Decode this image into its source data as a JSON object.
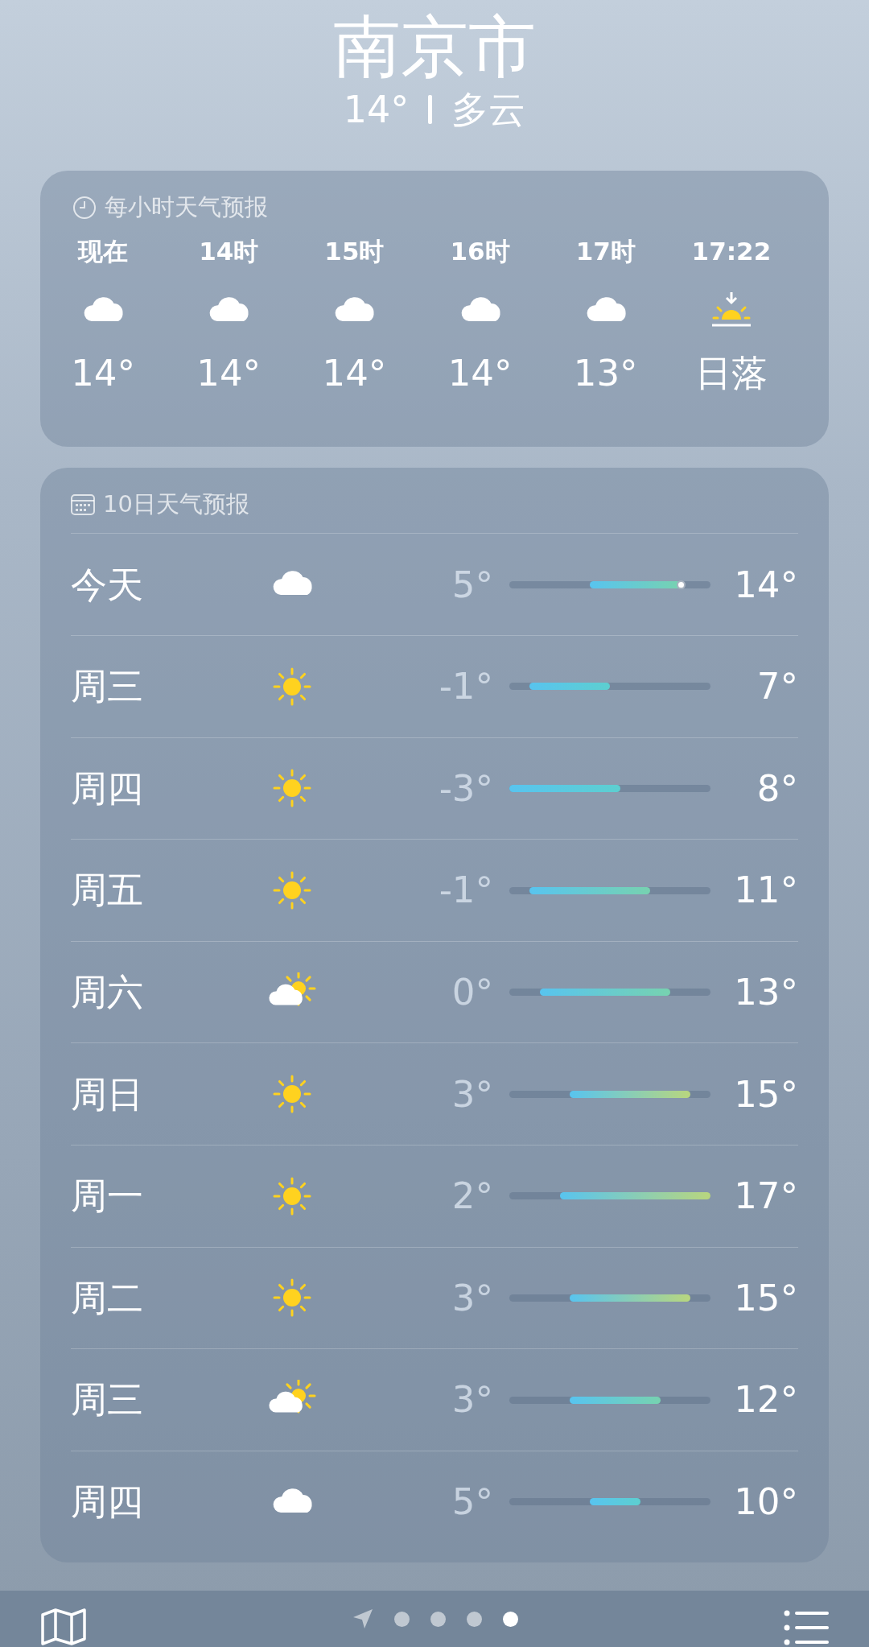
{
  "city": "南京市",
  "summary": {
    "temp": "14°",
    "condition": "多云"
  },
  "hourly": {
    "title": "每小时天气预报",
    "items": [
      {
        "time": "现在",
        "kind": "cloudy",
        "value": "14°"
      },
      {
        "time": "14时",
        "kind": "cloudy",
        "value": "14°"
      },
      {
        "time": "15时",
        "kind": "cloudy",
        "value": "14°"
      },
      {
        "time": "16时",
        "kind": "cloudy",
        "value": "14°"
      },
      {
        "time": "17时",
        "kind": "cloudy",
        "value": "13°"
      },
      {
        "time": "17:22",
        "kind": "sunset",
        "value": "日落"
      }
    ]
  },
  "daily": {
    "title": "10日天气预报",
    "rows": [
      {
        "day": "今天",
        "kind": "cloudy",
        "low": "5°",
        "high": "14°",
        "current": true
      },
      {
        "day": "周三",
        "kind": "sunny",
        "low": "-1°",
        "high": "7°",
        "current": false
      },
      {
        "day": "周四",
        "kind": "sunny",
        "low": "-3°",
        "high": "8°",
        "current": false
      },
      {
        "day": "周五",
        "kind": "sunny",
        "low": "-1°",
        "high": "11°",
        "current": false
      },
      {
        "day": "周六",
        "kind": "partly_sunny",
        "low": "0°",
        "high": "13°",
        "current": false
      },
      {
        "day": "周日",
        "kind": "sunny",
        "low": "3°",
        "high": "15°",
        "current": false
      },
      {
        "day": "周一",
        "kind": "sunny",
        "low": "2°",
        "high": "17°",
        "current": false
      },
      {
        "day": "周二",
        "kind": "sunny",
        "low": "3°",
        "high": "15°",
        "current": false
      },
      {
        "day": "周三",
        "kind": "partly_sunny",
        "low": "3°",
        "high": "12°",
        "current": false
      },
      {
        "day": "周四",
        "kind": "cloudy",
        "low": "5°",
        "high": "10°",
        "current": false
      }
    ]
  },
  "pages": [
    {
      "selected": false
    },
    {
      "selected": false
    },
    {
      "selected": false
    },
    {
      "selected": true
    }
  ]
}
